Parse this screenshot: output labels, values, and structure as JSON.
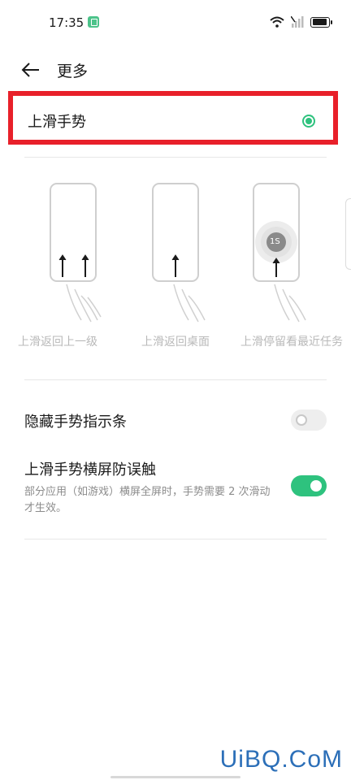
{
  "status_bar": {
    "time": "17:35"
  },
  "header": {
    "title": "更多"
  },
  "gesture_option": {
    "label": "上滑手势",
    "selected": true
  },
  "illustrations": [
    {
      "caption": "上滑返回上一级"
    },
    {
      "caption": "上滑返回桌面"
    },
    {
      "caption": "上滑停留看最近任务",
      "badge": "1S"
    }
  ],
  "settings": [
    {
      "title": "隐藏手势指示条",
      "description": "",
      "enabled": false
    },
    {
      "title": "上滑手势横屏防误触",
      "description": "部分应用（如游戏）横屏全屏时，手势需要 2 次滑动才生效。",
      "enabled": true
    }
  ],
  "watermark": "UiBQ.CoM",
  "colors": {
    "accent": "#2ec27e",
    "highlight": "#e8202a"
  }
}
